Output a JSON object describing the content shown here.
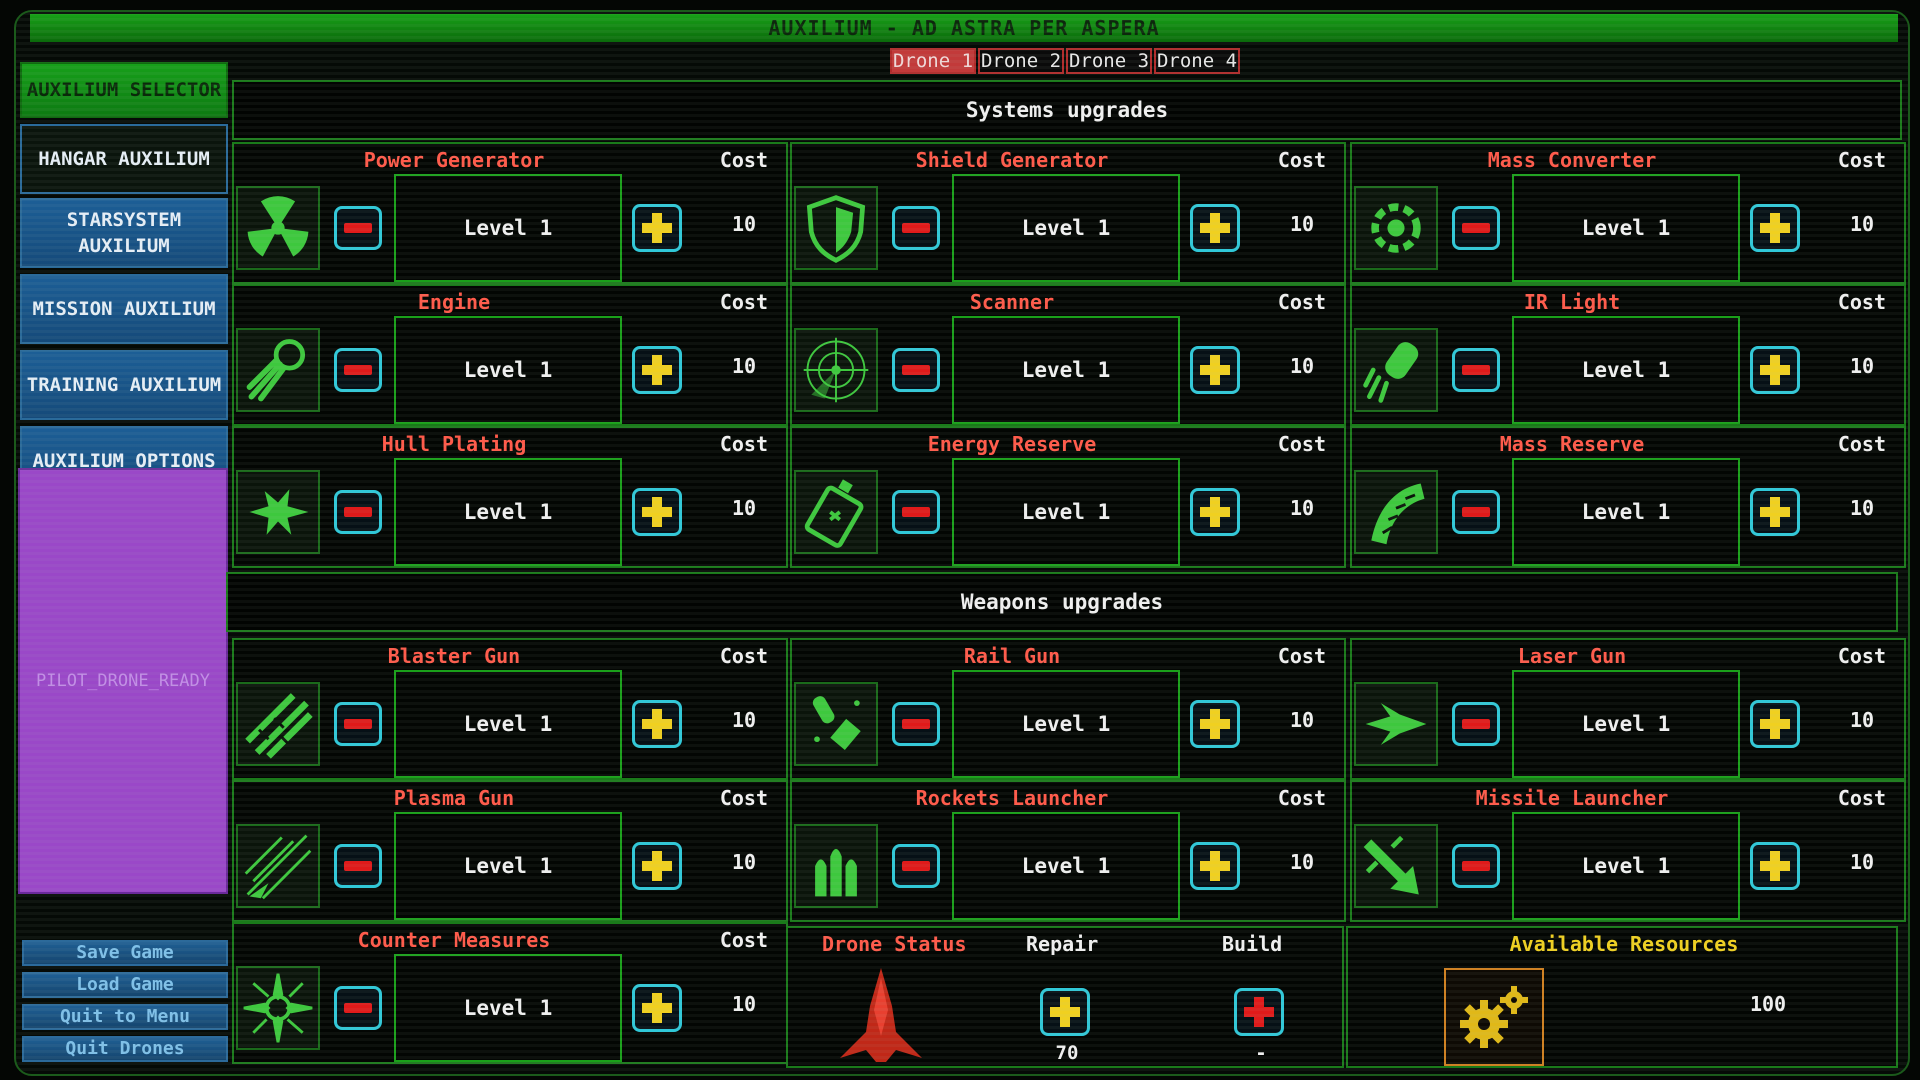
{
  "title": "AUXILIUM - AD ASTRA PER ASPERA",
  "sidebar": {
    "selector_label": "AUXILIUM SELECTOR",
    "items": [
      {
        "label": "HANGAR AUXILIUM"
      },
      {
        "label": "STARSYSTEM AUXILIUM"
      },
      {
        "label": "MISSION AUXILIUM"
      },
      {
        "label": "TRAINING AUXILIUM"
      },
      {
        "label": "AUXILIUM OPTIONS"
      }
    ],
    "pilot_status": "PILOT_DRONE_READY",
    "bottom_buttons": [
      {
        "label": "Save Game"
      },
      {
        "label": "Load Game"
      },
      {
        "label": "Quit to Menu"
      },
      {
        "label": "Quit Drones"
      }
    ]
  },
  "tabs": [
    {
      "label": "Drone 1",
      "active": true
    },
    {
      "label": "Drone 2",
      "active": false
    },
    {
      "label": "Drone 3",
      "active": false
    },
    {
      "label": "Drone 4",
      "active": false
    }
  ],
  "systems_header": "Systems upgrades",
  "weapons_header": "Weapons upgrades",
  "cost_label": "Cost",
  "systems": [
    {
      "name": "Power Generator",
      "level": "Level 1",
      "cost": "10",
      "icon": "radiation-icon"
    },
    {
      "name": "Shield Generator",
      "level": "Level 1",
      "cost": "10",
      "icon": "shield-icon"
    },
    {
      "name": "Mass Converter",
      "level": "Level 1",
      "cost": "10",
      "icon": "gear-ring-icon"
    },
    {
      "name": "Engine",
      "level": "Level 1",
      "cost": "10",
      "icon": "comet-icon"
    },
    {
      "name": "Scanner",
      "level": "Level 1",
      "cost": "10",
      "icon": "radar-icon"
    },
    {
      "name": "IR Light",
      "level": "Level 1",
      "cost": "10",
      "icon": "flashlight-icon"
    },
    {
      "name": "Hull Plating",
      "level": "Level 1",
      "cost": "10",
      "icon": "impact-icon"
    },
    {
      "name": "Energy Reserve",
      "level": "Level 1",
      "cost": "10",
      "icon": "battery-icon"
    },
    {
      "name": "Mass Reserve",
      "level": "Level 1",
      "cost": "10",
      "icon": "ammo-belt-icon"
    }
  ],
  "weapons": [
    {
      "name": "Blaster Gun",
      "level": "Level 1",
      "cost": "10",
      "icon": "laser-beams-icon"
    },
    {
      "name": "Rail Gun",
      "level": "Level 1",
      "cost": "10",
      "icon": "bullet-icon"
    },
    {
      "name": "Laser Gun",
      "level": "Level 1",
      "cost": "10",
      "icon": "laser-burst-icon"
    },
    {
      "name": "Plasma Gun",
      "level": "Level 1",
      "cost": "10",
      "icon": "plasma-icon"
    },
    {
      "name": "Rockets Launcher",
      "level": "Level 1",
      "cost": "10",
      "icon": "rockets-icon"
    },
    {
      "name": "Missile Launcher",
      "level": "Level 1",
      "cost": "10",
      "icon": "missile-icon"
    },
    {
      "name": "Counter Measures",
      "level": "Level 1",
      "cost": "10",
      "icon": "spiked-burst-icon"
    }
  ],
  "drone_status": {
    "label": "Drone Status",
    "repair_label": "Repair",
    "build_label": "Build",
    "repair_cost": "70",
    "build_cost": "-"
  },
  "resources": {
    "label": "Available Resources",
    "value": "100",
    "icon": "gears-icon"
  },
  "colors": {
    "frame_green": "#1a7a1a",
    "title_red": "#ff5a4a",
    "plus_yellow": "#f0d020",
    "minus_red": "#e01a1a",
    "button_cyan": "#30c8d8",
    "sidebar_blue": "#1c5e96",
    "pilot_purple": "#9a48c8"
  }
}
